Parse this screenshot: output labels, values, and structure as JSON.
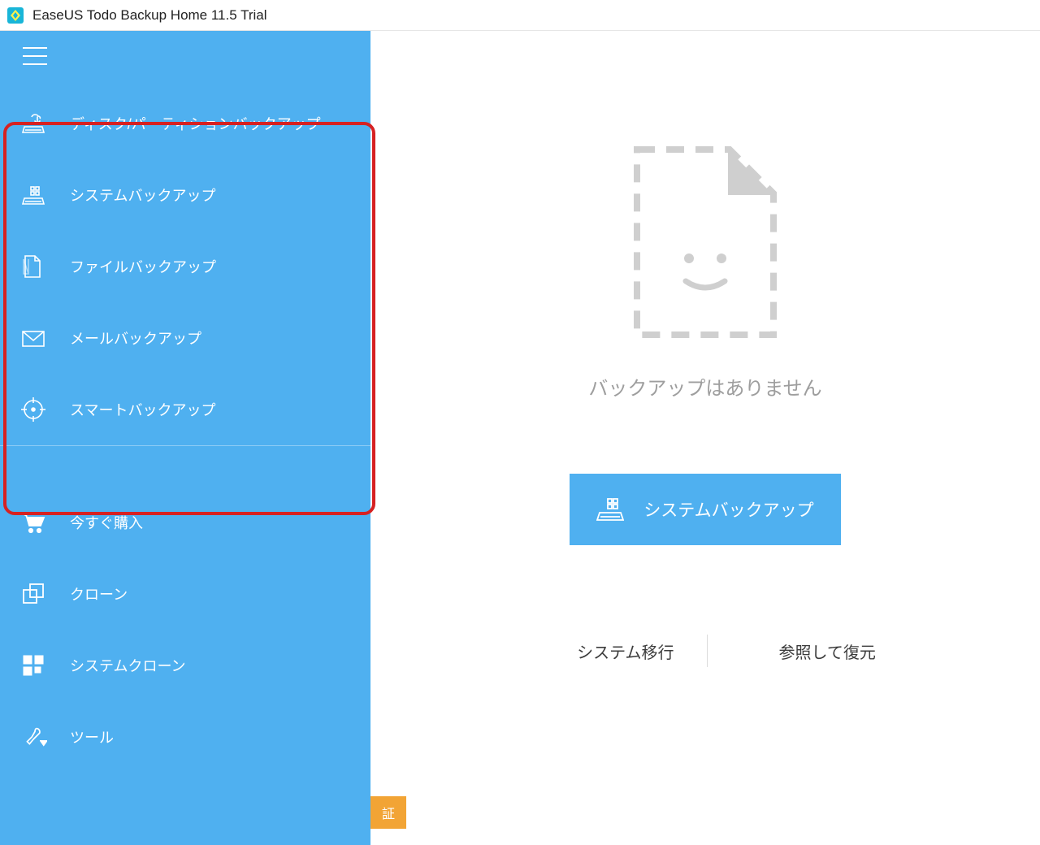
{
  "titlebar": {
    "title": "EaseUS Todo Backup Home 11.5 Trial"
  },
  "sidebar": {
    "items": [
      {
        "label": "ディスク/パーティションバックアップ",
        "icon": "disk-icon"
      },
      {
        "label": "システムバックアップ",
        "icon": "system-disk-icon"
      },
      {
        "label": "ファイルバックアップ",
        "icon": "file-icon"
      },
      {
        "label": "メールバックアップ",
        "icon": "mail-icon"
      },
      {
        "label": "スマートバックアップ",
        "icon": "target-icon"
      }
    ],
    "secondary": [
      {
        "label": "今すぐ購入",
        "icon": "cart-icon"
      },
      {
        "label": "クローン",
        "icon": "clone-icon"
      },
      {
        "label": "システムクローン",
        "icon": "tiles-icon"
      },
      {
        "label": "ツール",
        "icon": "wrench-icon"
      }
    ]
  },
  "main": {
    "empty_message": "バックアップはありません",
    "primary_button_label": "システムバックアップ",
    "actions": {
      "migrate_label": "システム移行",
      "browse_restore_label": "参照して復元"
    },
    "activate_partial": "証"
  },
  "colors": {
    "accent": "#4fb0f0",
    "annotation": "#d62122",
    "banner": "#f2a435"
  }
}
